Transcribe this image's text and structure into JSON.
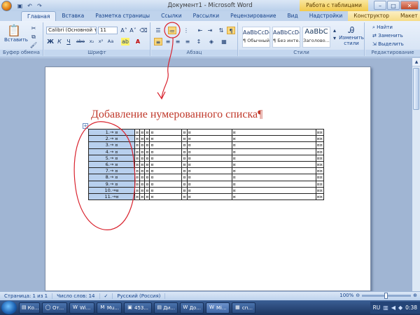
{
  "window": {
    "title": "Документ1 - Microsoft Word",
    "context_title": "Работа с таблицами",
    "qat": [
      "save-icon",
      "undo-icon",
      "redo-icon"
    ]
  },
  "tabs": [
    "Главная",
    "Вставка",
    "Разметка страницы",
    "Ссылки",
    "Рассылки",
    "Рецензирование",
    "Вид",
    "Надстройки",
    "Конструктор",
    "Макет"
  ],
  "ribbon": {
    "clipboard": {
      "label": "Буфер обмена",
      "paste": "Вставить"
    },
    "font": {
      "label": "Шрифт",
      "name": "Calibri (Основной те",
      "size": "11",
      "bold": "Ж",
      "italic": "К",
      "underline": "Ч",
      "strike": "abe",
      "sub": "x₂",
      "sup": "x²",
      "case": "Aa"
    },
    "paragraph": {
      "label": "Абзац"
    },
    "styles": {
      "label": "Стили",
      "items": [
        {
          "sample": "AaBbCcDc",
          "name": "¶ Обычный"
        },
        {
          "sample": "AaBbCcDc",
          "name": "¶ Без инте..."
        },
        {
          "sample": "AaBbC",
          "name": "Заголово..."
        }
      ],
      "change": "Изменить стили"
    },
    "editing": {
      "label": "Редактирование",
      "find": "Найти",
      "replace": "Заменить",
      "select": "Выделить"
    }
  },
  "document": {
    "heading": "Добавление нумерованного списка",
    "pilcrow": "¶",
    "rows": [
      "1.→ ¤",
      "2.→ ¤",
      "3.→ ¤",
      "4.→ ¤",
      "5.→ ¤",
      "6.→ ¤",
      "7.→ ¤",
      "8.→ ¤",
      "9.→ ¤",
      "10.→¤",
      "11.→¤"
    ],
    "cell_mark": "¤",
    "end_mark": "¤¤"
  },
  "statusbar": {
    "page": "Страница: 1 из 1",
    "words": "Число слов: 14",
    "lang": "Русский (Россия)",
    "zoom": "100%"
  },
  "taskbar": {
    "items": [
      "Ко...",
      "От...",
      "Wi...",
      "Mu...",
      "453...",
      "Ди...",
      "До...",
      "Mi...",
      "сп..."
    ],
    "lang": "RU",
    "time": "0:38"
  },
  "colors": {
    "annotation": "#d9232e",
    "heading": "#c0392b",
    "numcell_bg": "#b8d0ee"
  }
}
